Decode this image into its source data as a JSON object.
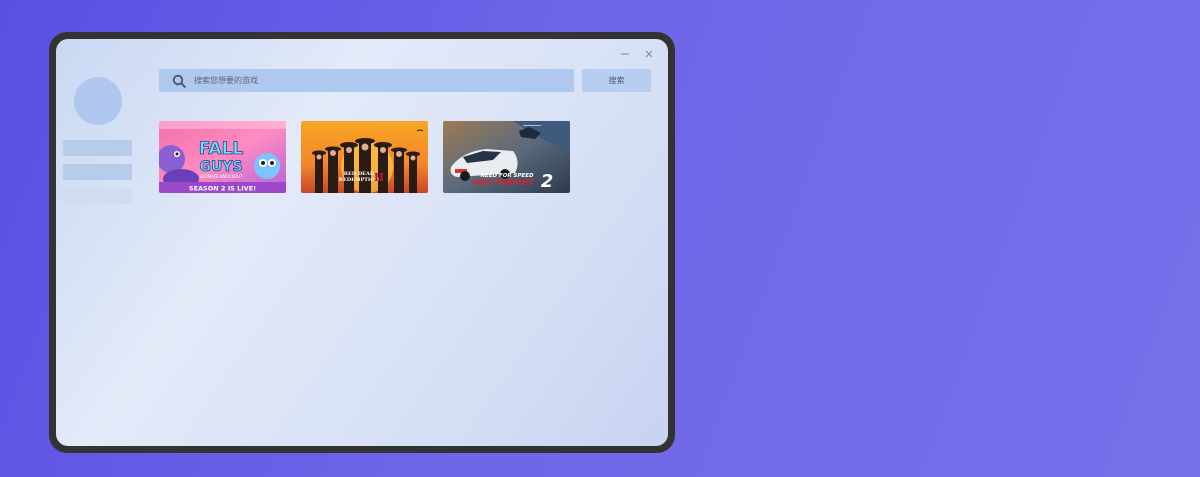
{
  "window": {
    "minimize_icon": "minimize-icon",
    "close_icon": "close-icon"
  },
  "search": {
    "placeholder": "搜索您想要的游戏",
    "button_label": "搜索",
    "icon": "search-icon"
  },
  "games": [
    {
      "title_line1": "FALL",
      "title_line2": "GUYS",
      "subtitle": "ULTIMATE KNOCKOUT",
      "banner": "SEASON 2 IS LIVE!"
    },
    {
      "title_line1": "RED DEAD",
      "title_line2": "REDEMPTION",
      "numeral": "II"
    },
    {
      "title_line1": "NEED FOR SPEED",
      "title_line2": "HOT PURSUIT",
      "numeral": "2"
    }
  ],
  "colors": {
    "background": "#5a4fe3",
    "device_frame": "#333333",
    "search_bar": "#aec8f0",
    "search_button": "#b7cdf1",
    "sidebar_item": "#b9cbea",
    "avatar": "#afc6ef"
  }
}
